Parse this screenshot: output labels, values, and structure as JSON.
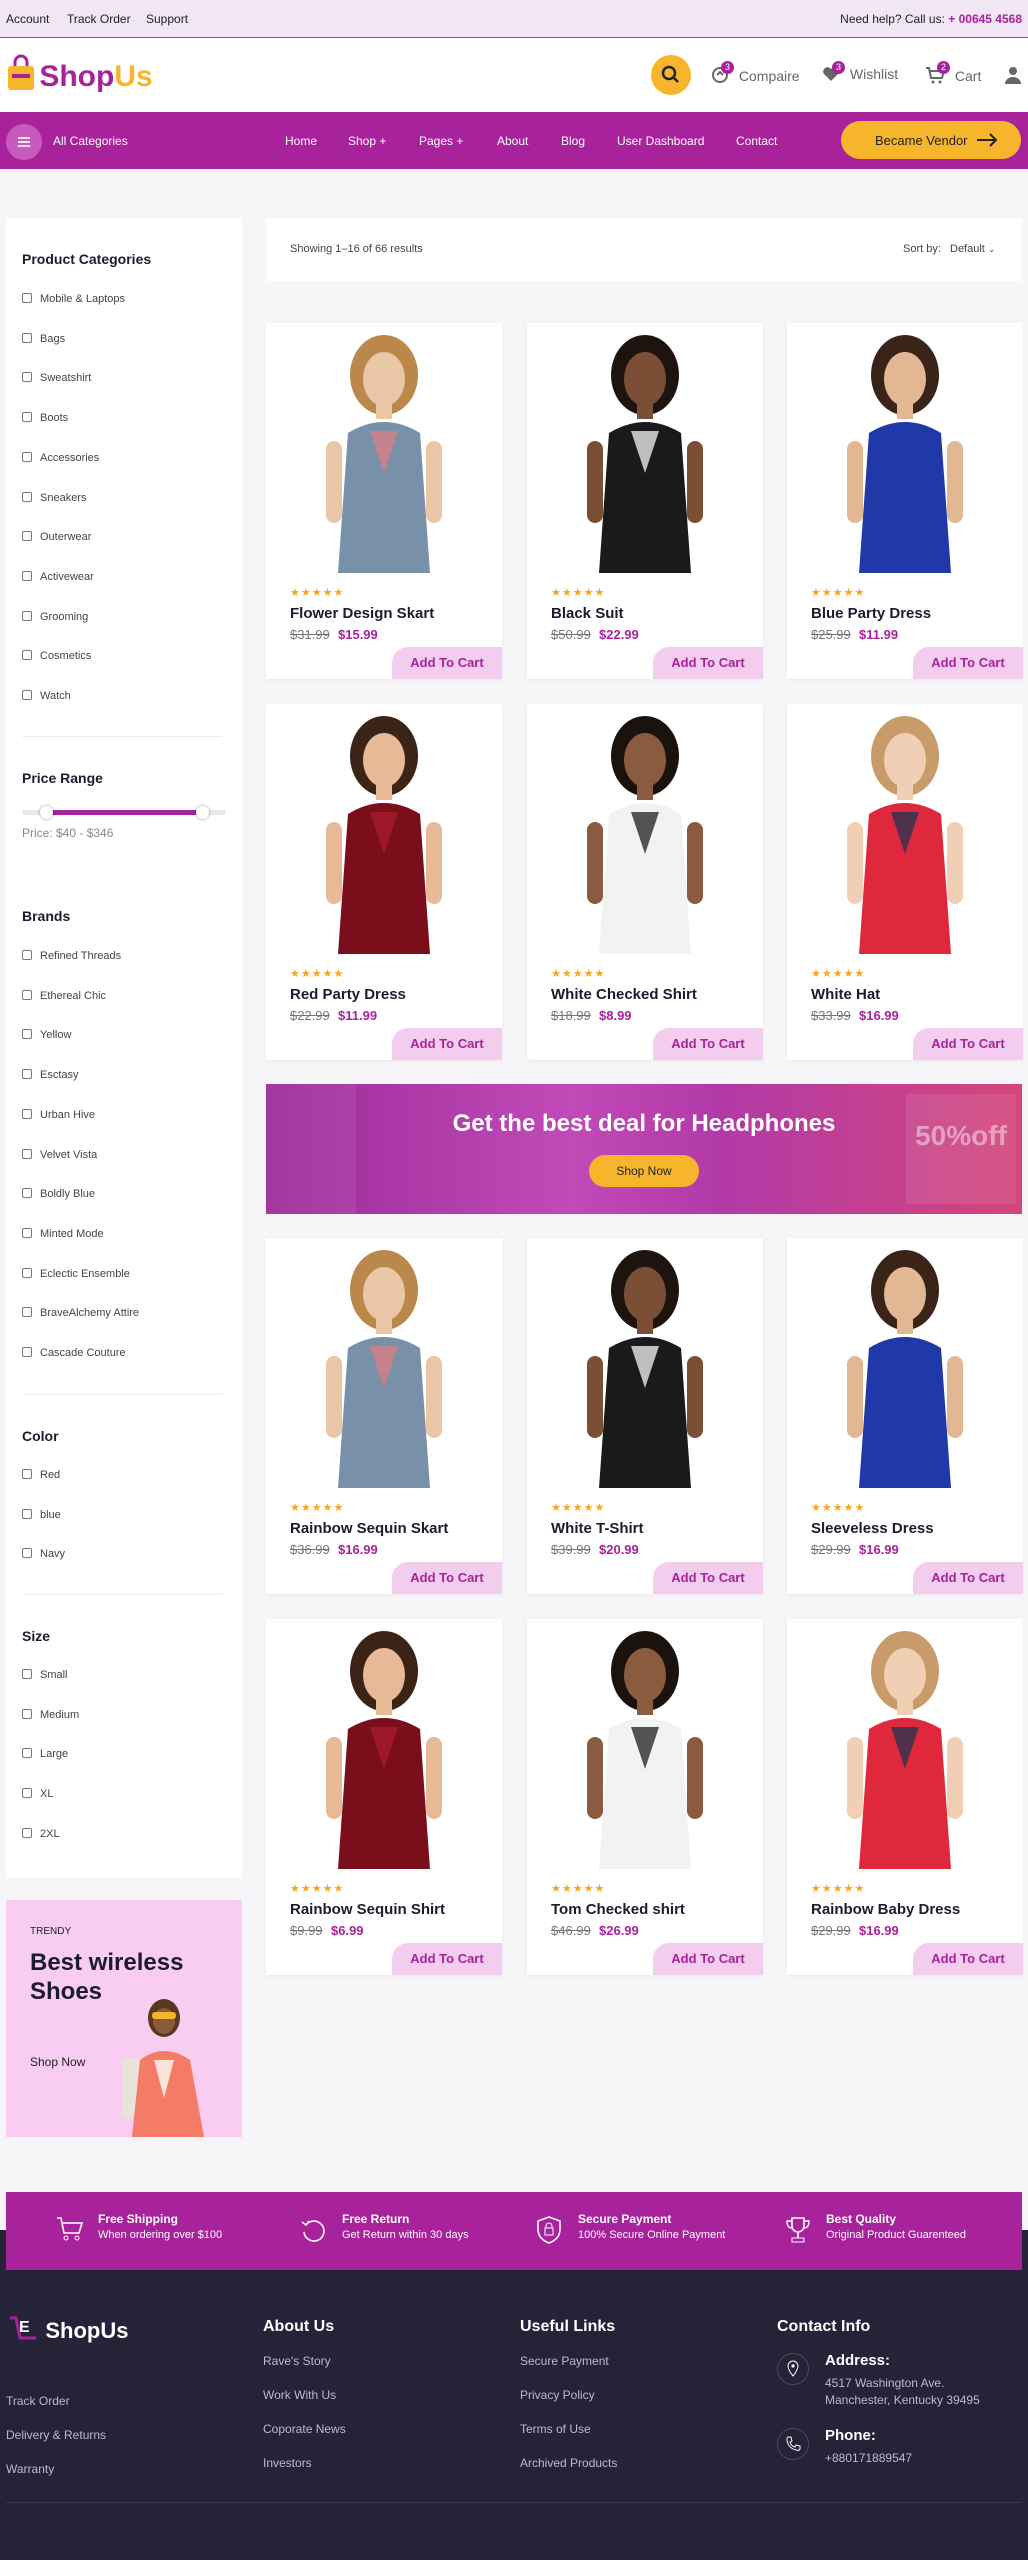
{
  "topbar": {
    "links": [
      "Account",
      "Track Order",
      "Support"
    ],
    "help_label": "Need help? Call us:",
    "help_phone": "+ 00645 4568"
  },
  "header": {
    "logo_main": "Shop",
    "logo_accent": "Us",
    "compare_label": "Compaire",
    "compare_count": "3",
    "wishlist_label": "Wishlist",
    "wishlist_count": "3",
    "cart_label": "Cart",
    "cart_count": "2"
  },
  "nav": {
    "all_categories": "All Categories",
    "items": [
      "Home",
      "Shop +",
      "Pages +",
      "About",
      "Blog",
      "User Dashboard",
      "Contact"
    ],
    "vendor_label": "Became Vendor"
  },
  "sidebar": {
    "categories_title": "Product Categories",
    "categories": [
      "Mobile & Laptops",
      "Bags",
      "Sweatshirt",
      "Boots",
      "Accessories",
      "Sneakers",
      "Outerwear",
      "Activewear",
      "Grooming",
      "Cosmetics",
      "Watch"
    ],
    "price_title": "Price Range",
    "price_text": "Price: $40 - $346",
    "price_range": {
      "min_fraction": 0.12,
      "max_fraction": 0.88
    },
    "brands_title": "Brands",
    "brands": [
      "Refined Threads",
      "Ethereal Chic",
      "Yellow",
      "Esctasy",
      "Urban Hive",
      "Velvet Vista",
      "Boldly Blue",
      "Minted Mode",
      "Eclectic Ensemble",
      "BraveAlchemy Attire",
      "Cascade Couture"
    ],
    "color_title": "Color",
    "colors": [
      "Red",
      "blue",
      "Navy"
    ],
    "size_title": "Size",
    "sizes": [
      "Small",
      "Medium",
      "Large",
      "XL",
      "2XL"
    ]
  },
  "promo": {
    "tag": "TRENDY",
    "title_line1": "Best wireless",
    "title_line2": "Shoes",
    "cta": "Shop Now"
  },
  "results": {
    "showing": "Showing 1–16 of 66 results",
    "sort_label": "Sort by:",
    "sort_value": "Default"
  },
  "products": [
    {
      "title": "Flower Design Skart",
      "old": "$31.99",
      "price": "$15.99",
      "stars": "★★★★★",
      "cart": "Add To Cart"
    },
    {
      "title": "Black Suit",
      "old": "$50.99",
      "price": "$22.99",
      "stars": "★★★★★",
      "cart": "Add To Cart"
    },
    {
      "title": "Blue Party Dress",
      "old": "$25.99",
      "price": "$11.99",
      "stars": "★★★★★",
      "cart": "Add To Cart"
    },
    {
      "title": "Red Party Dress",
      "old": "$22.99",
      "price": "$11.99",
      "stars": "★★★★★",
      "cart": "Add To Cart"
    },
    {
      "title": "White Checked Shirt",
      "old": "$18.99",
      "price": "$8.99",
      "stars": "★★★★★",
      "cart": "Add To Cart"
    },
    {
      "title": "White Hat",
      "old": "$33.99",
      "price": "$16.99",
      "stars": "★★★★★",
      "cart": "Add To Cart"
    },
    {
      "title": "Rainbow Sequin Skart",
      "old": "$36.99",
      "price": "$16.99",
      "stars": "★★★★★",
      "cart": "Add To Cart"
    },
    {
      "title": "White T-Shirt",
      "old": "$39.99",
      "price": "$20.99",
      "stars": "★★★★★",
      "cart": "Add To Cart"
    },
    {
      "title": "Sleeveless Dress",
      "old": "$29.99",
      "price": "$16.99",
      "stars": "★★★★★",
      "cart": "Add To Cart"
    },
    {
      "title": "Rainbow Sequin Shirt",
      "old": "$9.99",
      "price": "$6.99",
      "stars": "★★★★★",
      "cart": "Add To Cart"
    },
    {
      "title": "Tom Checked shirt",
      "old": "$46.99",
      "price": "$26.99",
      "stars": "★★★★★",
      "cart": "Add To Cart"
    },
    {
      "title": "Rainbow Baby Dress",
      "old": "$29.99",
      "price": "$16.99",
      "stars": "★★★★★",
      "cart": "Add To Cart"
    }
  ],
  "banner": {
    "title": "Get the best deal for Headphones",
    "cta": "Shop Now",
    "sign_text": "50%off"
  },
  "features": [
    {
      "title": "Free Shipping",
      "sub": "When ordering over $100"
    },
    {
      "title": "Free Return",
      "sub": "Get Return within 30 days"
    },
    {
      "title": "Secure Payment",
      "sub": "100% Secure Online Payment"
    },
    {
      "title": "Best Quality",
      "sub": "Original Product Guarenteed"
    }
  ],
  "footer": {
    "logo": "ShopUs",
    "col1_links": [
      "Track Order",
      "Delivery & Returns",
      "Warranty"
    ],
    "about_title": "About Us",
    "about_links": [
      "Rave's Story",
      "Work With Us",
      "Coporate News",
      "Investors"
    ],
    "useful_title": "Useful Links",
    "useful_links": [
      "Secure Payment",
      "Privacy Policy",
      "Terms of Use",
      "Archived Products"
    ],
    "contact_title": "Contact Info",
    "address_label": "Address:",
    "address_line1": "4517 Washington Ave.",
    "address_line2": "Manchester, Kentucky 39495",
    "phone_label": "Phone:",
    "phone": "+880171889547"
  },
  "colors": {
    "brand": "#a8229c",
    "accent": "#f7b52c",
    "footer": "#252338"
  }
}
